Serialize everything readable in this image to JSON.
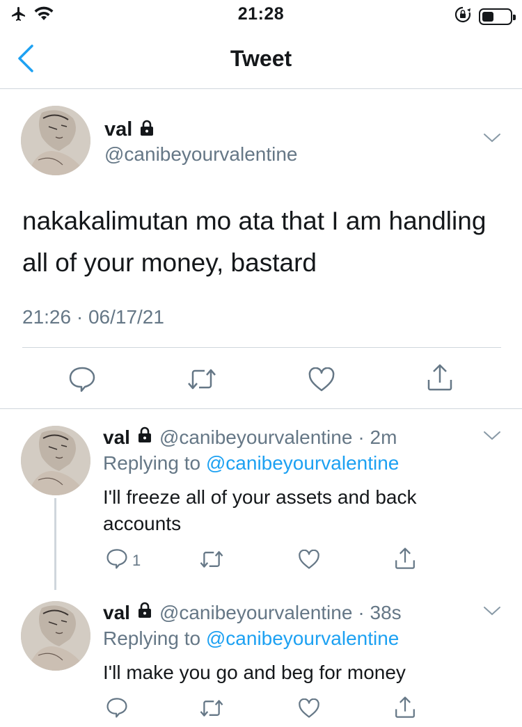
{
  "status_bar": {
    "time": "21:28",
    "icons": [
      "airplane-icon",
      "wifi-icon",
      "orientation-lock-icon",
      "battery-icon"
    ]
  },
  "nav": {
    "title": "Tweet",
    "back_icon": "chevron-left-icon"
  },
  "main_tweet": {
    "name": "val",
    "handle": "@canibeyourvalentine",
    "text": "nakakalimutan mo ata that I am handling all of your money, bastard",
    "meta": "21:26 · 06/17/21",
    "actions": [
      "reply-icon",
      "retweet-icon",
      "like-icon",
      "share-icon"
    ]
  },
  "replies": [
    {
      "name": "val",
      "handle": "@canibeyourvalentine",
      "time": "· 2m",
      "replying_prefix": "Replying to ",
      "replying_to": "@canibeyourvalentine",
      "text": "I'll freeze all of your assets and back accounts",
      "reply_count": "1"
    },
    {
      "name": "val",
      "handle": "@canibeyourvalentine",
      "time": "· 38s",
      "replying_prefix": "Replying to ",
      "replying_to": "@canibeyourvalentine",
      "text": "I'll make you go and beg for money",
      "reply_count": ""
    }
  ],
  "colors": {
    "accent": "#1da1f2",
    "secondary_text": "#657786",
    "divider": "#cfd6dc",
    "primary_text": "#14171a"
  }
}
